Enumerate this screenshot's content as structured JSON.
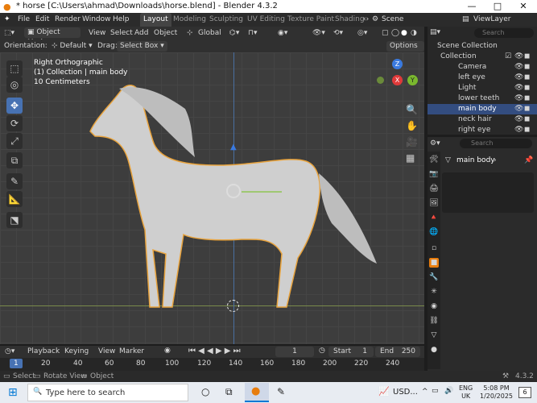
{
  "window": {
    "title": "* horse [C:\\Users\\ahmad\\Downloads\\horse.blend] - Blender 4.3.2",
    "minimize": "—",
    "maximize": "□",
    "close": "✕"
  },
  "menu": [
    "File",
    "Edit",
    "Render",
    "Window",
    "Help"
  ],
  "workspaces": [
    "Layout",
    "Modeling",
    "Sculpting",
    "UV Editing",
    "Texture Paint",
    "Shading"
  ],
  "scene": {
    "scene_label": "Scene",
    "viewlayer_label": "ViewLayer"
  },
  "viewport_header": {
    "mode": "Object Mode",
    "view": "View",
    "select": "Select",
    "add": "Add",
    "object": "Object",
    "orientation_global": "Global"
  },
  "tool_header": {
    "orientation_label": "Orientation:",
    "orientation_value": "Default",
    "drag_label": "Drag:",
    "drag_value": "Select Box",
    "options": "Options"
  },
  "viewport_info": {
    "view_name": "Right Orthographic",
    "collection_line": "(1) Collection | main body",
    "scale": "10 Centimeters"
  },
  "gizmo_axes": {
    "z": "Z",
    "y": "Y",
    "x": "X"
  },
  "outliner": {
    "search_placeholder": "Search",
    "root": "Scene Collection",
    "collection": "Collection",
    "items": [
      {
        "label": "Camera",
        "selected": false
      },
      {
        "label": "left eye",
        "selected": false
      },
      {
        "label": "Light",
        "selected": false
      },
      {
        "label": "lower teeth",
        "selected": false
      },
      {
        "label": "main body",
        "selected": true
      },
      {
        "label": "neck hair",
        "selected": false
      },
      {
        "label": "right eye",
        "selected": false
      }
    ]
  },
  "properties": {
    "search_placeholder": "Search",
    "object_name": "main body"
  },
  "timeline": {
    "playback": "Playback",
    "keying": "Keying",
    "view": "View",
    "marker": "Marker",
    "current_frame": "1",
    "start_label": "Start",
    "start_value": "1",
    "end_label": "End",
    "end_value": "250"
  },
  "ruler_ticks": [
    "1",
    "20",
    "40",
    "60",
    "80",
    "100",
    "120",
    "140",
    "160",
    "180",
    "200",
    "220",
    "240"
  ],
  "statusbar": {
    "select": "Select",
    "rotate": "Rotate View",
    "object": "Object",
    "version": "4.3.2"
  },
  "taskbar": {
    "search_placeholder": "Type here to search",
    "weather": "USD...",
    "lang_top": "ENG",
    "lang_bottom": "UK",
    "time": "5:08 PM",
    "date": "1/20/2025",
    "notifications": "6"
  },
  "colors": {
    "accent": "#4772b3",
    "selection_outline": "#e8a33d",
    "viewport_bg": "#3d3d3d",
    "axis_x": "#e03a3a",
    "axis_y": "#7ab82e",
    "axis_z": "#3a7ae0"
  }
}
